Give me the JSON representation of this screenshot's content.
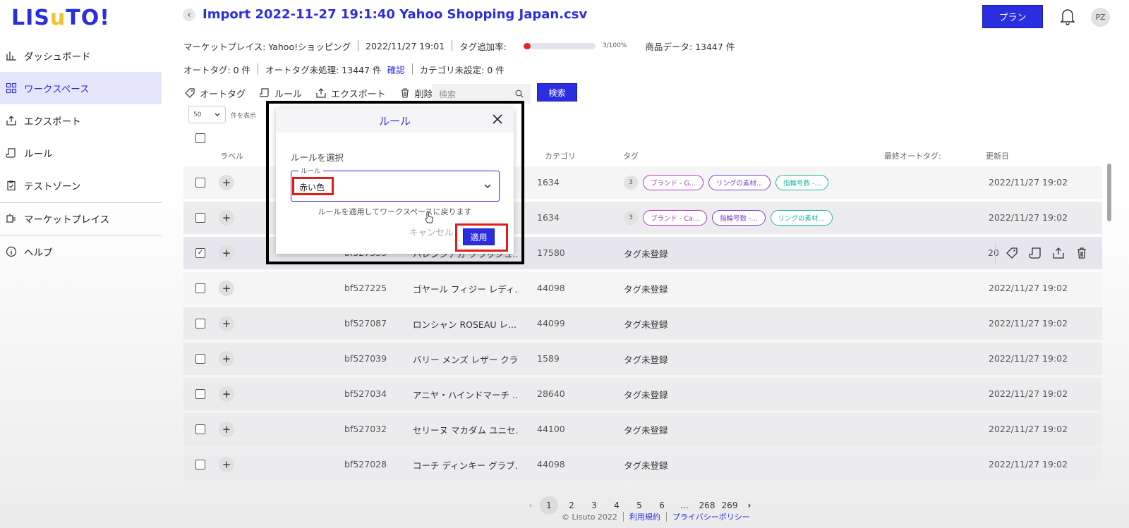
{
  "app": {
    "logo_prefix": "LIS",
    "logo_u": "u",
    "logo_suffix": "TO!"
  },
  "sidebar": {
    "items": [
      {
        "label": "ダッシュボード",
        "icon": "bar-chart-icon"
      },
      {
        "label": "ワークスペース",
        "icon": "grid-icon",
        "active": true
      },
      {
        "label": "エクスポート",
        "icon": "export-icon"
      },
      {
        "label": "ルール",
        "icon": "scroll-icon"
      },
      {
        "label": "テストゾーン",
        "icon": "clipboard-icon"
      },
      {
        "label": "マーケットプレイス",
        "icon": "plug-icon"
      },
      {
        "label": "ヘルプ",
        "icon": "info-icon"
      }
    ]
  },
  "header": {
    "title": "Import 2022-11-27 19:1:40 Yahoo Shopping Japan.csv",
    "plan_label": "プラン",
    "avatar": "PZ"
  },
  "info": {
    "marketplace": "マーケットプレイス: Yahoo!ショッピング",
    "datetime": "2022/11/27 19:01",
    "tag_rate_label": "タグ追加率:",
    "tag_rate_value": "3/100%",
    "tag_rate_fraction": 0.1,
    "product_data": "商品データ: 13447 件",
    "auto_tag": "オートタグ: 0 件",
    "auto_tag_pending": "オートタグ未処理: 13447 件",
    "confirm_link": "確認",
    "category_unset": "カテゴリ未設定: 0 件"
  },
  "toolbar": {
    "auto_tag": "オートタグ",
    "rule": "ルール",
    "export": "エクスポート",
    "delete": "削除",
    "search_placeholder": "検索",
    "search_button": "検索",
    "per_page": "50",
    "per_page_label": "件を表示"
  },
  "columns": {
    "label": "ラベル",
    "category": "カテゴリ",
    "tag": "タグ",
    "last_auto_tag": "最終オートタグ:",
    "updated": "更新日"
  },
  "rows": [
    {
      "code": "",
      "name": "",
      "category": "1634",
      "tag_count": "3",
      "tags": [
        "ブランド - G...",
        "リングの素材...",
        "指輪号数 -..."
      ],
      "date": "2022/11/27 19:02"
    },
    {
      "code": "",
      "name": "",
      "category": "1634",
      "tag_count": "3",
      "tags": [
        "ブランド - Ca...",
        "指輪号数 -...",
        "リングの素材..."
      ],
      "date": "2022/11/27 19:02"
    },
    {
      "code": "bf527333",
      "name": "バレンシアガ クラッシュ...",
      "category": "17580",
      "tag_text": "タグ未登録",
      "date": "20",
      "checked": "✓"
    },
    {
      "code": "bf527225",
      "name": "ゴヤール フィジー レディ...",
      "category": "44098",
      "tag_text": "タグ未登録",
      "date": "2022/11/27 19:02"
    },
    {
      "code": "bf527087",
      "name": "ロンシャン ROSEAU レ...",
      "category": "44099",
      "tag_text": "タグ未登録",
      "date": "2022/11/27 19:02"
    },
    {
      "code": "bf527039",
      "name": "バリー メンズ レザー クラ...",
      "category": "1589",
      "tag_text": "タグ未登録",
      "date": "2022/11/27 19:02"
    },
    {
      "code": "bf527034",
      "name": "アニヤ・ハインドマーチ ...",
      "category": "28640",
      "tag_text": "タグ未登録",
      "date": "2022/11/27 19:02"
    },
    {
      "code": "bf527032",
      "name": "セリーヌ マカダム ユニセ...",
      "category": "44100",
      "tag_text": "タグ未登録",
      "date": "2022/11/27 19:02"
    },
    {
      "code": "bf527028",
      "name": "コーチ ディンキー グラブ...",
      "category": "44098",
      "tag_text": "タグ未登録",
      "date": "2022/11/27 19:02"
    }
  ],
  "pagination": {
    "pages": [
      "1",
      "2",
      "3",
      "4",
      "5",
      "6",
      "...",
      "268",
      "269"
    ],
    "current": "1"
  },
  "footer": {
    "copyright": "© Lisuto 2022",
    "terms": "利用規約",
    "privacy": "プライバシーポリシー"
  },
  "modal": {
    "title": "ルール",
    "select_label": "ルールを選択",
    "field_legend": "ルール",
    "selected_rule": "赤い色",
    "hint": "ルールを適用してワークスペースに戻ります",
    "cancel": "キャンセル",
    "apply": "適用"
  },
  "colors": {
    "accent": "#2b2ee0",
    "highlight": "#e01c1c",
    "progress": "#d62c2c",
    "chip_magenta": "#b23bb8",
    "chip_purple": "#7a3fc8",
    "chip_teal": "#24b3a8"
  }
}
